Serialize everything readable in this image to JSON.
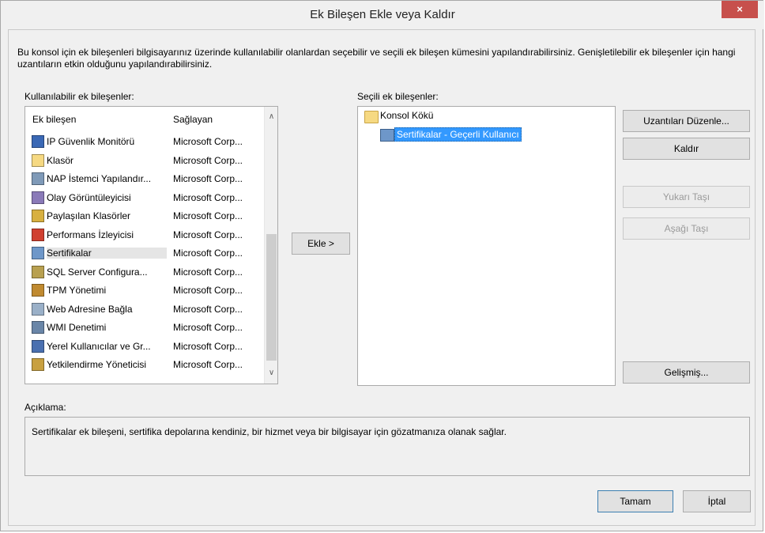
{
  "window": {
    "title": "Ek Bileşen Ekle veya Kaldır",
    "close_glyph": "×"
  },
  "intro_text": "Bu konsol için ek bileşenleri bilgisayarınız üzerinde kullanılabilir olanlardan seçebilir ve seçili ek bileşen kümesini yapılandırabilirsiniz. Genişletilebilir ek bileşenler için hangi uzantıların etkin olduğunu yapılandırabilirsiniz.",
  "available": {
    "label": "Kullanılabilir ek bileşenler:",
    "columns": {
      "snapin": "Ek bileşen",
      "vendor": "Sağlayan"
    },
    "items": [
      {
        "name": "IP Güvenlik Monitörü",
        "vendor": "Microsoft Corp...",
        "icon": "security-monitor-icon",
        "color": "#3a68b5"
      },
      {
        "name": "Klasör",
        "vendor": "Microsoft Corp...",
        "icon": "folder-icon",
        "color": "#f6d982"
      },
      {
        "name": "NAP İstemci Yapılandır...",
        "vendor": "Microsoft Corp...",
        "icon": "nap-client-icon",
        "color": "#7f9ab8"
      },
      {
        "name": "Olay Görüntüleyicisi",
        "vendor": "Microsoft Corp...",
        "icon": "event-viewer-icon",
        "color": "#8a7ab8"
      },
      {
        "name": "Paylaşılan Klasörler",
        "vendor": "Microsoft Corp...",
        "icon": "shared-folders-icon",
        "color": "#d8b040"
      },
      {
        "name": "Performans İzleyicisi",
        "vendor": "Microsoft Corp...",
        "icon": "performance-monitor-icon",
        "color": "#d04030"
      },
      {
        "name": "Sertifikalar",
        "vendor": "Microsoft Corp...",
        "icon": "certificates-icon",
        "color": "#6e97c9"
      },
      {
        "name": "SQL Server Configura...",
        "vendor": "Microsoft Corp...",
        "icon": "sql-server-icon",
        "color": "#b8a050"
      },
      {
        "name": "TPM Yönetimi",
        "vendor": "Microsoft Corp...",
        "icon": "tpm-icon",
        "color": "#c08a30"
      },
      {
        "name": "Web Adresine Bağla",
        "vendor": "Microsoft Corp...",
        "icon": "web-link-icon",
        "color": "#9ab0c8"
      },
      {
        "name": "WMI Denetimi",
        "vendor": "Microsoft Corp...",
        "icon": "wmi-control-icon",
        "color": "#6a86a8"
      },
      {
        "name": "Yerel Kullanıcılar ve Gr...",
        "vendor": "Microsoft Corp...",
        "icon": "local-users-icon",
        "color": "#4a70b0"
      },
      {
        "name": "Yetkilendirme Yöneticisi",
        "vendor": "Microsoft Corp...",
        "icon": "authorization-manager-icon",
        "color": "#c8a040"
      }
    ],
    "selected_item": "Sertifikalar"
  },
  "add_button": "Ekle >",
  "selected": {
    "label": "Seçili ek bileşenler:",
    "root": "Konsol Kökü",
    "child": "Sertifikalar - Geçerli Kullanıcı"
  },
  "buttons": {
    "edit_extensions": "Uzantıları Düzenle...",
    "remove": "Kaldır",
    "move_up": "Yukarı Taşı",
    "move_down": "Aşağı Taşı",
    "advanced": "Gelişmiş...",
    "ok": "Tamam",
    "cancel": "İptal"
  },
  "description": {
    "label": "Açıklama:",
    "text": "Sertifikalar ek bileşeni, sertifika depolarına kendiniz, bir hizmet veya bir bilgisayar için gözatmanıza olanak sağlar."
  },
  "colors": {
    "selection": "#3399ff",
    "close_button": "#c7504c",
    "dialog_bg": "#f0f0f0"
  }
}
